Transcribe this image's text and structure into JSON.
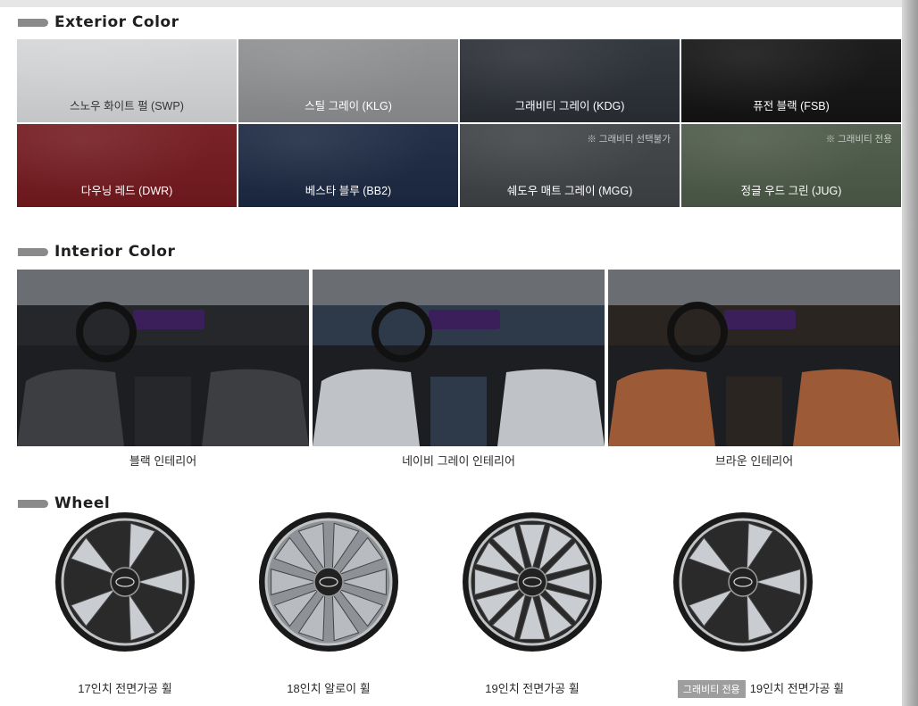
{
  "sections": {
    "exterior": "Exterior Color",
    "interior": "Interior Color",
    "wheel": "Wheel"
  },
  "exterior_colors": [
    {
      "label": "스노우 화이트 펄 (SWP)",
      "color": "#d4d6d7",
      "text_color": "#333333",
      "note": ""
    },
    {
      "label": "스틸 그레이 (KLG)",
      "color": "#8e8f91",
      "text_color": "#ffffff",
      "note": ""
    },
    {
      "label": "그래비티 그레이 (KDG)",
      "color": "#2b2f36",
      "text_color": "#ffffff",
      "note": ""
    },
    {
      "label": "퓨전 블랙 (FSB)",
      "color": "#141414",
      "text_color": "#ffffff",
      "note": ""
    },
    {
      "label": "다우닝 레드 (DWR)",
      "color": "#741a1f",
      "text_color": "#ffffff",
      "note": ""
    },
    {
      "label": "베스타 블루 (BB2)",
      "color": "#1c2942",
      "text_color": "#ffffff",
      "note": ""
    },
    {
      "label": "쉐도우 매트 그레이 (MGG)",
      "color": "#3f4245",
      "text_color": "#ffffff",
      "note": "※ 그래비티 선택불가"
    },
    {
      "label": "정글 우드 그린 (JUG)",
      "color": "#4d5a48",
      "text_color": "#ffffff",
      "note": "※ 그래비티 전용"
    }
  ],
  "interior_colors": [
    {
      "label": "블랙 인테리어",
      "seat": "#3d3e41",
      "trim": "#26272a"
    },
    {
      "label": "네이비 그레이 인테리어",
      "seat": "#bfc3c7",
      "trim": "#2e3a4a"
    },
    {
      "label": "브라운 인테리어",
      "seat": "#9c5a36",
      "trim": "#2b2522"
    }
  ],
  "wheels": [
    {
      "label": "17인치 전면가공 휠",
      "badge": ""
    },
    {
      "label": "18인치 알로이 휠",
      "badge": ""
    },
    {
      "label": "19인치 전면가공 휠",
      "badge": ""
    },
    {
      "label": "19인치 전면가공 휠",
      "badge": "그래비티 전용"
    }
  ]
}
